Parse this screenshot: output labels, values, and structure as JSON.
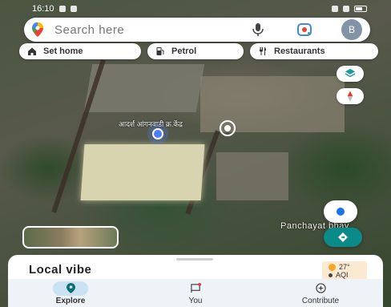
{
  "status_bar": {
    "time": "16:10"
  },
  "search": {
    "placeholder": "Search here",
    "avatar_initial": "B"
  },
  "chips": [
    {
      "label": "Set home",
      "icon": "home-icon"
    },
    {
      "label": "Petrol",
      "icon": "fuel-icon"
    },
    {
      "label": "Restaurants",
      "icon": "restaurant-icon"
    }
  ],
  "map": {
    "poi_label": "आदर्श आंगनवाडी क्र.केंद्र",
    "place_label": "Panchayat bhav"
  },
  "sheet": {
    "title": "Local vibe",
    "weather": {
      "temp": "27°",
      "aqi_label": "AQI"
    }
  },
  "nav": {
    "items": [
      {
        "label": "Explore",
        "icon": "location-pin-icon",
        "active": true
      },
      {
        "label": "You",
        "icon": "bookmark-flag-icon",
        "active": false
      },
      {
        "label": "Contribute",
        "icon": "add-circle-icon",
        "active": false
      }
    ]
  },
  "colors": {
    "accent": "#1a73e8",
    "active_tab_bg": "#c9e3f3",
    "go_button": "#0b8a8a"
  }
}
